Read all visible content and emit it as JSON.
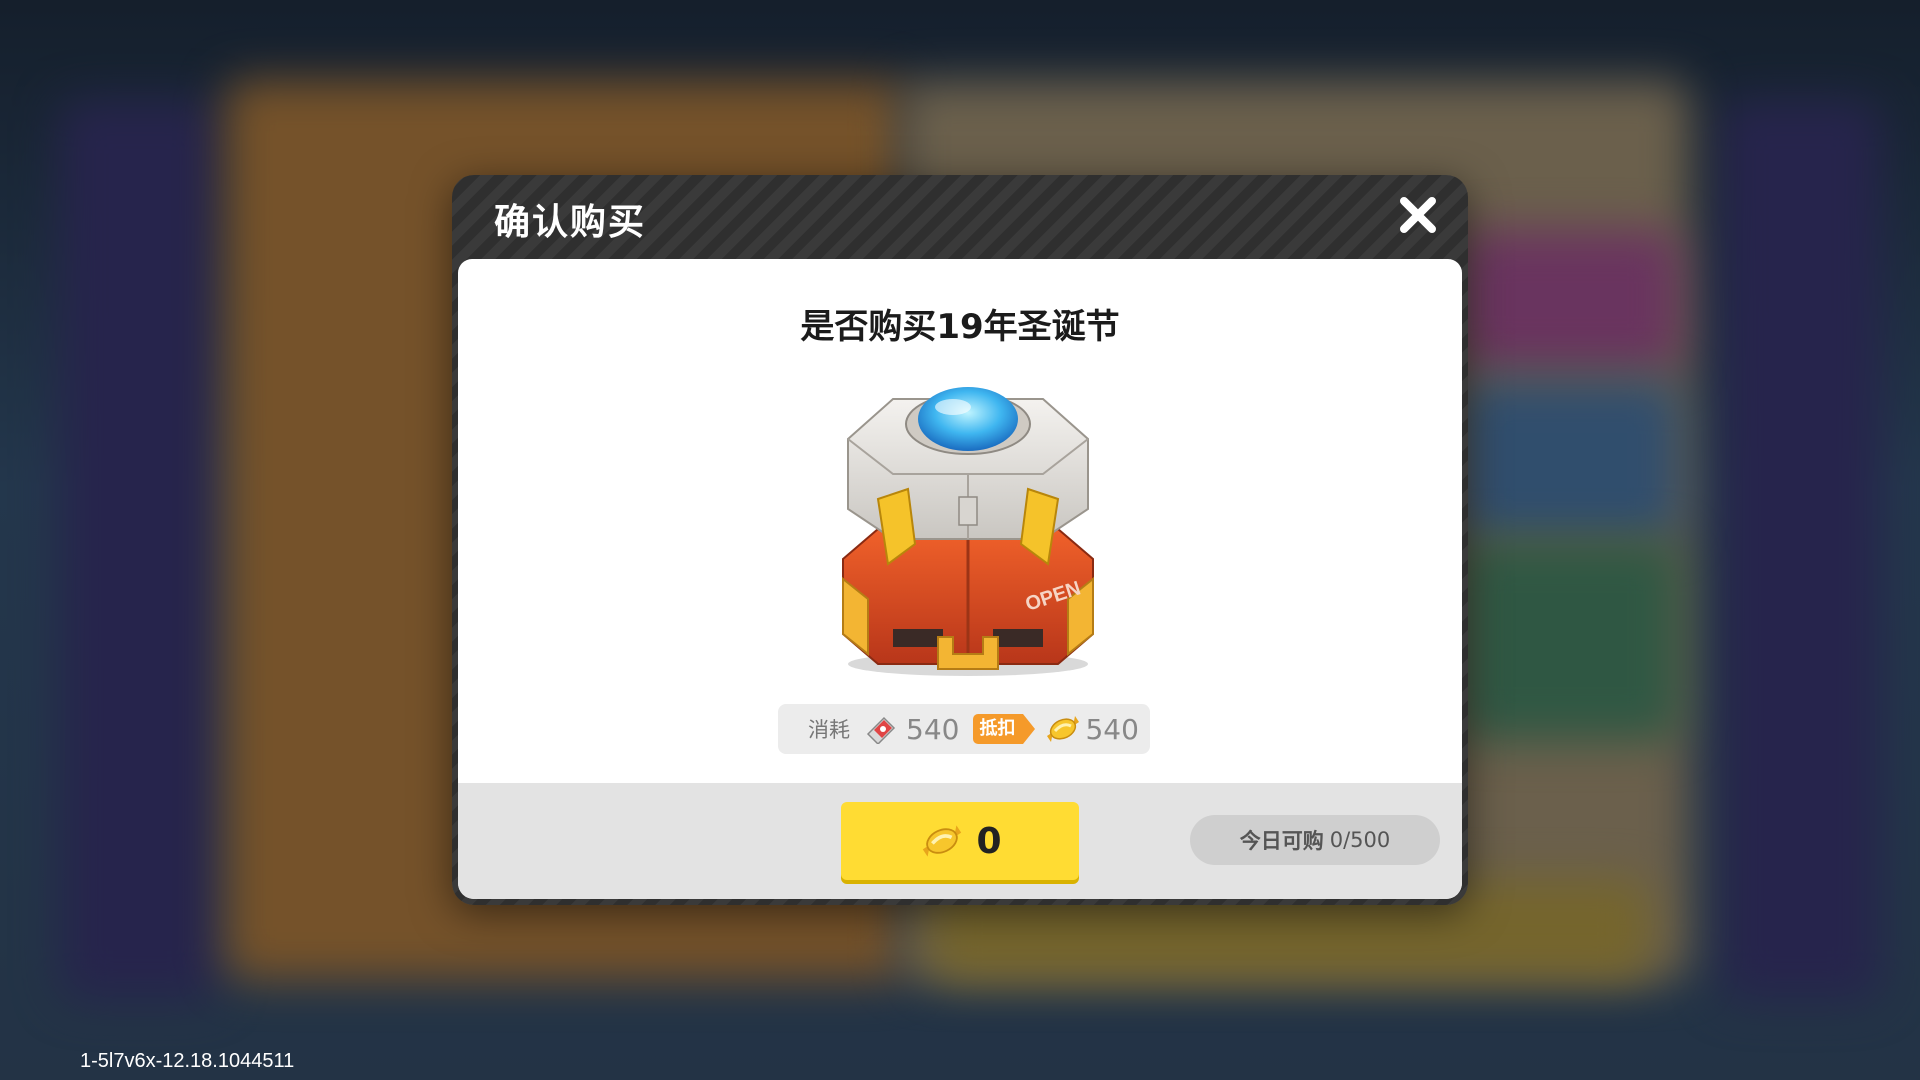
{
  "dialog": {
    "title": "确认购买",
    "question": "是否购买19年圣诞节",
    "close_icon": "close-icon"
  },
  "item": {
    "image_icon": "loot-box-image"
  },
  "cost": {
    "label": "消耗",
    "ticket_icon": "coupon-ticket-icon",
    "ticket_amount": "540",
    "deduct_label": "抵扣",
    "candy_icon": "candy-currency-icon",
    "candy_amount": "540"
  },
  "purchase": {
    "currency_icon": "candy-currency-icon",
    "price": "0",
    "daily_limit_label": "今日可购",
    "daily_limit_value": "0/500"
  },
  "build_version": "1-5l7v6x-12.18.1044511",
  "colors": {
    "buy_button": "#ffdc33",
    "deduct_tag": "#f59a2a",
    "dialog_header": "#3a3a3a"
  }
}
